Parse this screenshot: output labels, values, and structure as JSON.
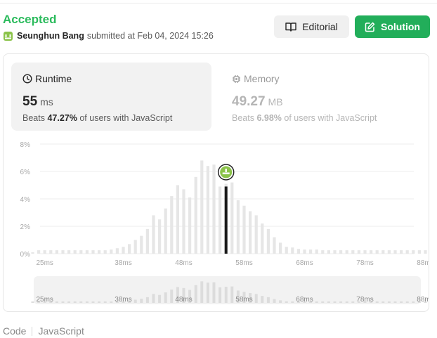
{
  "header": {
    "status": "Accepted",
    "username": "Seunghun Bang",
    "submitted_text": "submitted at Feb 04, 2024 15:26",
    "editorial_label": "Editorial",
    "solution_label": "Solution"
  },
  "runtime_tab": {
    "label": "Runtime",
    "value": "55",
    "unit": "ms",
    "beats_prefix": "Beats",
    "beats_percent": "47.27%",
    "beats_suffix": "of users with JavaScript"
  },
  "memory_tab": {
    "label": "Memory",
    "value": "49.27",
    "unit": "MB",
    "beats_prefix": "Beats",
    "beats_percent": "6.98%",
    "beats_suffix": "of users with JavaScript"
  },
  "code_bar": {
    "label": "Code",
    "language": "JavaScript"
  },
  "chart_data": {
    "type": "bar",
    "title": "",
    "xlabel": "",
    "ylabel": "",
    "ylim": [
      0,
      8
    ],
    "y_ticks": [
      "0%",
      "2%",
      "4%",
      "6%",
      "8%"
    ],
    "x_tick_labels": [
      "25ms",
      "38ms",
      "48ms",
      "58ms",
      "68ms",
      "78ms",
      "88ms"
    ],
    "x_tick_values": [
      25,
      38,
      48,
      58,
      68,
      78,
      88
    ],
    "bin_start_ms": 23,
    "bin_width_ms": 1,
    "values": [
      0.1,
      0.25,
      0.25,
      0.25,
      0.25,
      0.25,
      0.25,
      0.25,
      0.25,
      0.25,
      0.25,
      0.25,
      0.25,
      0.3,
      0.4,
      0.5,
      0.7,
      1,
      1.3,
      1.8,
      2.8,
      2.5,
      3.3,
      4.2,
      5,
      4.7,
      4.1,
      5.6,
      6.8,
      6.4,
      6.5,
      4.9,
      5.1,
      5.2,
      3.9,
      3.5,
      3.1,
      2.8,
      2.2,
      1.8,
      1.2,
      0.8,
      0.5,
      0.45,
      0.35,
      0.3,
      0.3,
      0.3,
      0.25,
      0.25,
      0.25,
      0.25,
      0.25,
      0.25,
      0.25,
      0.25,
      0.25,
      0.25,
      0.25,
      0.25,
      0.25,
      0.25,
      0.25,
      0.25,
      0.25,
      0.25,
      0.25,
      0.25,
      0.25,
      0.25,
      0.25,
      0.25,
      0.25,
      0.25,
      0.25
    ],
    "highlight_ms": 55,
    "highlight_value": 4.9,
    "grid": true,
    "legend": "none",
    "bar_color": "#e6e6e6",
    "highlight_color": "#1a1a1a"
  },
  "colors": {
    "accepted_green": "#2cbb5d",
    "solution_button": "#22ae5a",
    "runtime_tab_bg": "#f2f2f2",
    "navigator_bg": "#f2f2f2",
    "avatar_green": "#8bc34a"
  },
  "icons": {
    "avatar": "avatar-icon",
    "editorial": "book-icon",
    "solution": "edit-icon",
    "runtime": "clock-icon",
    "memory": "chip-icon"
  }
}
